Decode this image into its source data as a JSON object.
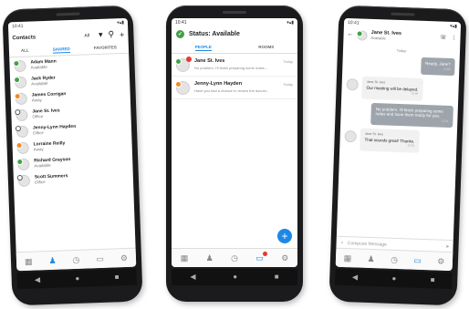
{
  "contacts_screen": {
    "title": "Contacts",
    "filter_value": "All",
    "tabs": [
      "ALL",
      "SHARED",
      "FAVORITES"
    ],
    "contacts": [
      {
        "name": "Adam Mann",
        "status": "Available",
        "presence": "available"
      },
      {
        "name": "Jack Ryder",
        "status": "Available",
        "presence": "available"
      },
      {
        "name": "James Corrigan",
        "status": "Away",
        "presence": "away"
      },
      {
        "name": "Jane St. Ives",
        "status": "Office",
        "presence": "offline"
      },
      {
        "name": "Jenny-Lynn Hayden",
        "status": "Office",
        "presence": "offline"
      },
      {
        "name": "Lorraine Reilly",
        "status": "Away",
        "presence": "away"
      },
      {
        "name": "Richard Grayson",
        "status": "Available",
        "presence": "available"
      },
      {
        "name": "Scott Summers",
        "status": "Office",
        "presence": "offline"
      }
    ]
  },
  "status_screen": {
    "title": "Status: Available",
    "tabs": [
      "PEOPLE",
      "ROOMS"
    ],
    "conversations": [
      {
        "name": "Jane St. Ives",
        "preview": "No problem, I'll finish preparing some notes...",
        "time": "Today",
        "unread": true,
        "presence": "available"
      },
      {
        "name": "Jenny-Lynn Hayden",
        "preview": "Have you had a chance to review the docum...",
        "time": "Today",
        "unread": false,
        "presence": "away"
      }
    ],
    "fab_label": "+"
  },
  "chat_screen": {
    "contact_name": "Jane St. Ives",
    "contact_status": "Available",
    "day_label": "Today",
    "messages": [
      {
        "direction": "out",
        "text": "Ready, Jane?",
        "time": "12:00"
      },
      {
        "direction": "in",
        "sender": "Jane St. Ives",
        "text": "Our meeting will be delayed.",
        "time": "12:00"
      },
      {
        "direction": "out",
        "text": "No problem. I'll finish preparing some notes and have them ready for you.",
        "time": "12:01"
      },
      {
        "direction": "in",
        "sender": "Jane St. Ives",
        "text": "That sounds great! Thanks.",
        "time": "12:01"
      }
    ],
    "composer_placeholder": "Compose Message"
  },
  "status_bar_time": "10:41",
  "colors": {
    "accent": "#1e88e5",
    "available": "#43a047",
    "away": "#f4891e",
    "badge": "#e53935"
  },
  "icons": [
    "search-icon",
    "add-icon",
    "dialpad-icon",
    "person-icon",
    "clock-icon",
    "chat-icon",
    "gear-icon",
    "back-icon",
    "phone-icon",
    "more-icon",
    "mic-icon",
    "send-icon"
  ]
}
